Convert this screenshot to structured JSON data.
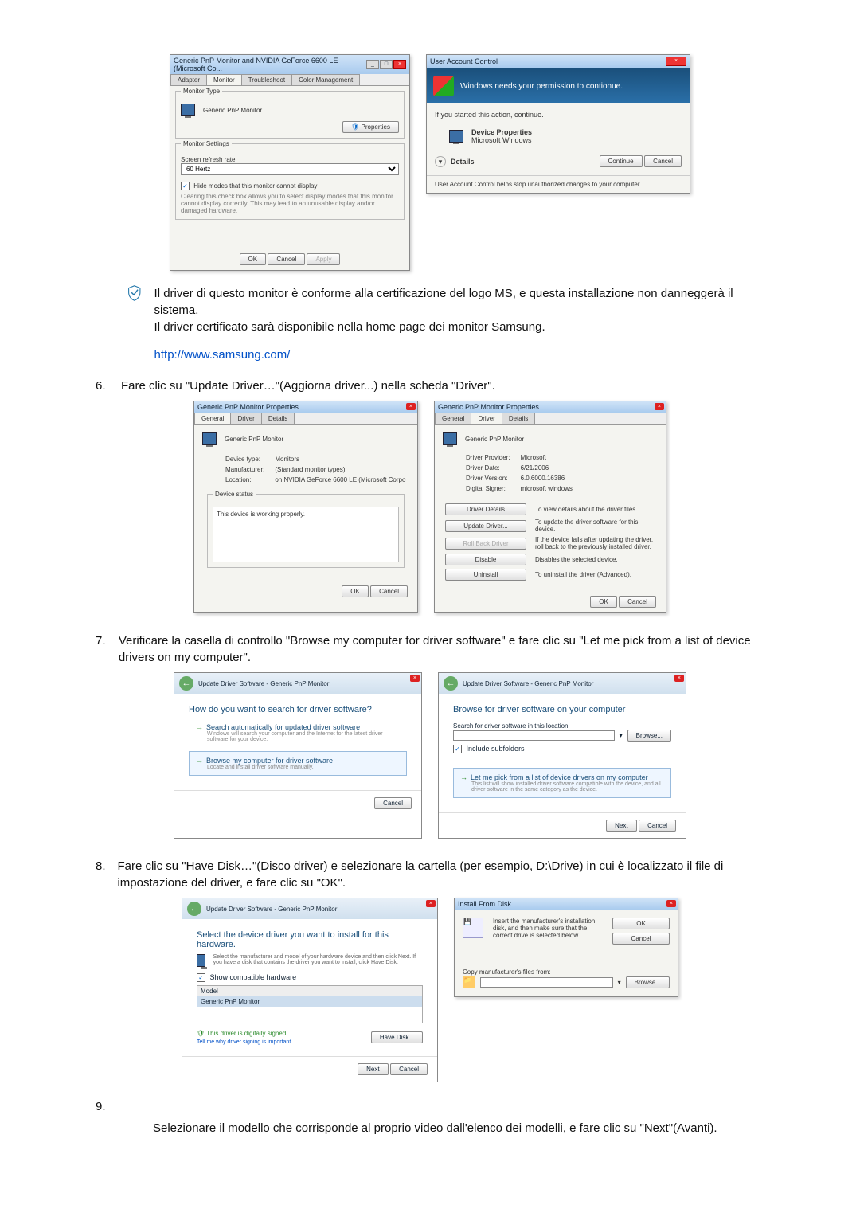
{
  "monitor_dialog": {
    "title": "Generic PnP Monitor and NVIDIA GeForce 6600 LE (Microsoft Co...",
    "tabs": [
      "Adapter",
      "Monitor",
      "Troubleshoot",
      "Color Management"
    ],
    "type_group": "Monitor Type",
    "type_value": "Generic PnP Monitor",
    "properties_btn": "Properties",
    "settings_group": "Monitor Settings",
    "refresh_label": "Screen refresh rate:",
    "refresh_value": "60 Hertz",
    "hide_modes_check": "Hide modes that this monitor cannot display",
    "hide_modes_note": "Clearing this check box allows you to select display modes that this monitor cannot display correctly. This may lead to an unusable display and/or damaged hardware.",
    "ok": "OK",
    "cancel": "Cancel",
    "apply": "Apply"
  },
  "uac": {
    "title": "User Account Control",
    "headline": "Windows needs your permission to contionue.",
    "started": "If you started this action, continue.",
    "prog_name": "Device Properties",
    "publisher": "Microsoft Windows",
    "details": "Details",
    "continue": "Continue",
    "cancel": "Cancel",
    "footer": "User Account Control helps stop unauthorized changes to your computer."
  },
  "note_block": {
    "l1": "Il driver di questo monitor è conforme alla certificazione del logo MS, e questa installazione non danneggerà il sistema.",
    "l2": "Il driver certificato sarà disponibile nella home page dei monitor Samsung.",
    "url": "http://www.samsung.com/"
  },
  "step6": {
    "num": "6.",
    "text": "Fare clic su \"Update Driver…\"(Aggiorna driver...) nella scheda \"Driver\"."
  },
  "prop_general": {
    "title": "Generic PnP Monitor Properties",
    "tabs": [
      "General",
      "Driver",
      "Details"
    ],
    "name": "Generic PnP Monitor",
    "devtype_l": "Device type:",
    "devtype_v": "Monitors",
    "mfr_l": "Manufacturer:",
    "mfr_v": "(Standard monitor types)",
    "loc_l": "Location:",
    "loc_v": "on NVIDIA GeForce 6600 LE (Microsoft Corpo",
    "status_group": "Device status",
    "status_text": "This device is working properly.",
    "ok": "OK",
    "cancel": "Cancel"
  },
  "prop_driver": {
    "title": "Generic PnP Monitor Properties",
    "tabs": [
      "General",
      "Driver",
      "Details"
    ],
    "name": "Generic PnP Monitor",
    "prov_l": "Driver Provider:",
    "prov_v": "Microsoft",
    "date_l": "Driver Date:",
    "date_v": "6/21/2006",
    "ver_l": "Driver Version:",
    "ver_v": "6.0.6000.16386",
    "sign_l": "Digital Signer:",
    "sign_v": "microsoft windows",
    "b1": "Driver Details",
    "b1d": "To view details about the driver files.",
    "b2": "Update Driver...",
    "b2d": "To update the driver software for this device.",
    "b3": "Roll Back Driver",
    "b3d": "If the device fails after updating the driver, roll back to the previously installed driver.",
    "b4": "Disable",
    "b4d": "Disables the selected device.",
    "b5": "Uninstall",
    "b5d": "To uninstall the driver (Advanced).",
    "ok": "OK",
    "cancel": "Cancel"
  },
  "step7": {
    "num": "7.",
    "text": "Verificare la casella di controllo \"Browse my computer for driver software\" e fare clic su \"Let me pick from a list of device drivers on my computer\"."
  },
  "wiz_search": {
    "crumb": "Update Driver Software - Generic PnP Monitor",
    "heading": "How do you want to search for driver software?",
    "opt1_t": "Search automatically for updated driver software",
    "opt1_d": "Windows will search your computer and the Internet for the latest driver software for your device.",
    "opt2_t": "Browse my computer for driver software",
    "opt2_d": "Locate and install driver software manually.",
    "cancel": "Cancel"
  },
  "wiz_browse": {
    "crumb": "Update Driver Software - Generic PnP Monitor",
    "heading": "Browse for driver software on your computer",
    "loc_label": "Search for driver software in this location:",
    "browse": "Browse...",
    "inc_sub": "Include subfolders",
    "opt_t": "Let me pick from a list of device drivers on my computer",
    "opt_d": "This list will show installed driver software compatible with the device, and all driver software in the same category as the device.",
    "next": "Next",
    "cancel": "Cancel"
  },
  "step8": {
    "num": "8.",
    "text": "Fare clic su \"Have Disk…\"(Disco driver) e selezionare la cartella (per esempio, D:\\Drive) in cui è localizzato il file di impostazione del driver, e fare clic su \"OK\"."
  },
  "wiz_select": {
    "crumb": "Update Driver Software - Generic PnP Monitor",
    "heading": "Select the device driver you want to install for this hardware.",
    "note": "Select the manufacturer and model of your hardware device and then click Next. If you have a disk that contains the driver you want to install, click Have Disk.",
    "compat": "Show compatible hardware",
    "model": "Model",
    "item": "Generic PnP Monitor",
    "signed": "This driver is digitally signed.",
    "tell": "Tell me why driver signing is important",
    "have_disk": "Have Disk...",
    "next": "Next",
    "cancel": "Cancel"
  },
  "install_disk": {
    "title": "Install From Disk",
    "msg": "Insert the manufacturer's installation disk, and then make sure that the correct drive is selected below.",
    "ok": "OK",
    "cancel": "Cancel",
    "copy": "Copy manufacturer's files from:",
    "browse": "Browse..."
  },
  "step9": {
    "num": "9.",
    "text": "Selezionare il modello che corrisponde al proprio video dall'elenco dei modelli, e fare clic su \"Next\"(Avanti)."
  }
}
